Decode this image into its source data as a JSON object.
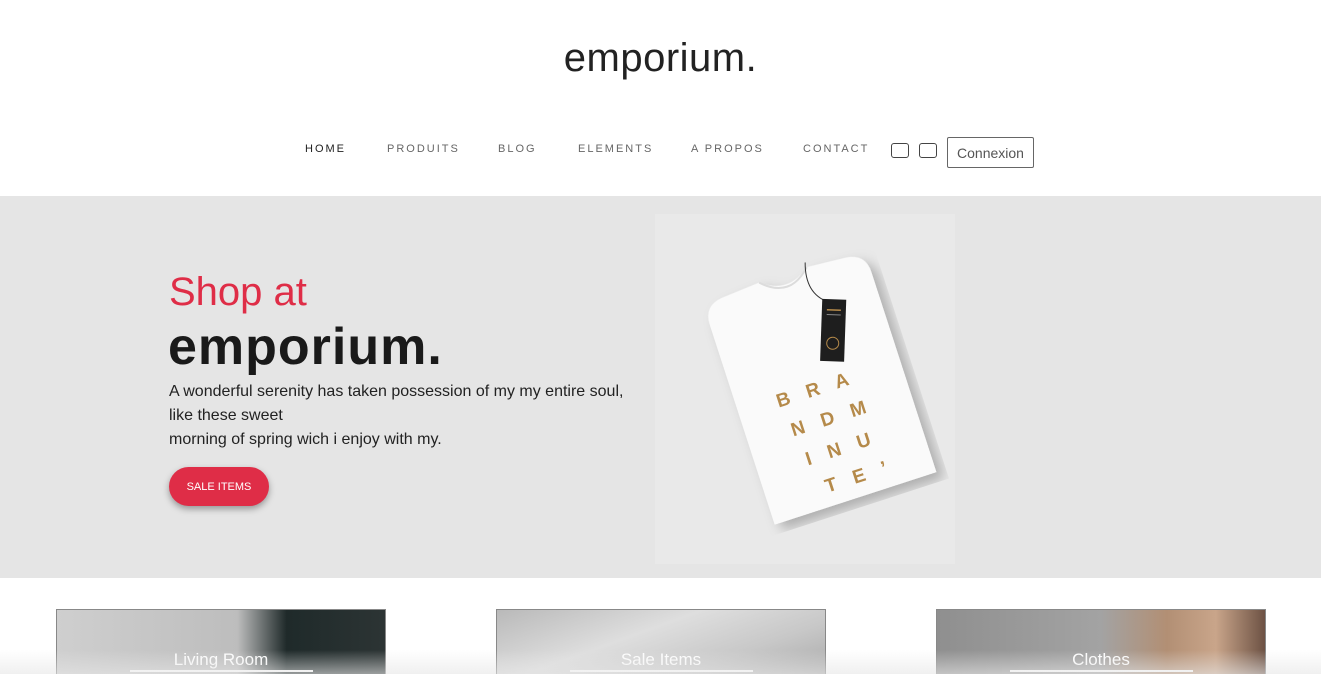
{
  "header": {
    "logo": "emporium."
  },
  "nav": {
    "items": [
      {
        "label": "HOME",
        "active": true
      },
      {
        "label": "PRODUITS",
        "active": false
      },
      {
        "label": "BLOG",
        "active": false
      },
      {
        "label": "ELEMENTS",
        "active": false
      },
      {
        "label": "A PROPOS",
        "active": false
      },
      {
        "label": "CONTACT",
        "active": false
      }
    ],
    "icons": [
      "checkbox-icon",
      "checkbox-icon"
    ],
    "login_label": "Connexion"
  },
  "hero": {
    "title_line1": "Shop at",
    "title_line2": "emporium.",
    "description": [
      "A wonderful serenity has taken possession of my my entire soul,",
      "like these sweet",
      "morning of spring wich i enjoy with my."
    ],
    "button_label": "SALE ITEMS",
    "tshirt_print": [
      "B R A",
      "N D  M",
      "I  N U",
      "T  E ’"
    ]
  },
  "categories": [
    {
      "label": "Living Room"
    },
    {
      "label": "Sale Items"
    },
    {
      "label": "Clothes"
    }
  ],
  "colors": {
    "accent": "#df2d47",
    "hero_bg": "#e5e5e5",
    "text": "#222222"
  }
}
